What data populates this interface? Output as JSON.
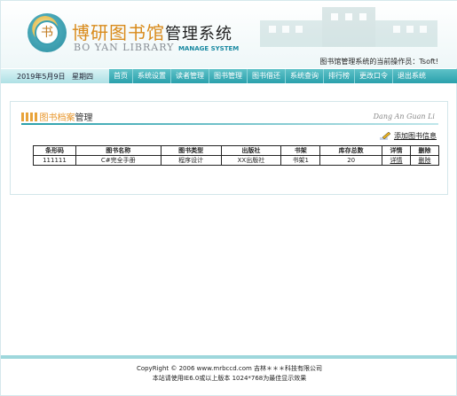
{
  "header": {
    "logo_char": "书",
    "title_cn_styled": "博研图书馆",
    "title_cn_plain": "管理系统",
    "title_en": "BO YAN LIBRARY",
    "title_en_sub": "MANAGE SYSTEM",
    "operator_label": "图书馆管理系统的当前操作员：Tsoft!"
  },
  "nav": {
    "date": "2019年5月9日",
    "weekday": "星期四",
    "items": [
      "首页",
      "系统设置",
      "读者管理",
      "图书管理",
      "图书借还",
      "系统查询",
      "排行榜",
      "更改口令",
      "退出系统"
    ]
  },
  "section": {
    "title_highlight": "图书档案",
    "title_rest": "管理",
    "pinyin": "Dang An Guan Li",
    "add_link": "添加图书信息"
  },
  "table": {
    "headers": [
      "条形码",
      "图书名称",
      "图书类型",
      "出版社",
      "书架",
      "库存总数",
      "详情",
      "删除"
    ],
    "rows": [
      [
        "111111",
        "C#完全手册",
        "程序设计",
        "XX出版社",
        "书架1",
        "20",
        "详情",
        "删除"
      ]
    ]
  },
  "footer": {
    "line1": "CopyRight © 2006 www.mrbccd.com 吉林＊＊＊科技有限公司",
    "line2": "本站请使用IE6.0或以上版本 1024*768为最佳显示效果"
  },
  "colors": {
    "nav_bg": "#2aa0ac",
    "accent_orange": "#e8962a",
    "footer_bar": "#9ed7dc"
  }
}
